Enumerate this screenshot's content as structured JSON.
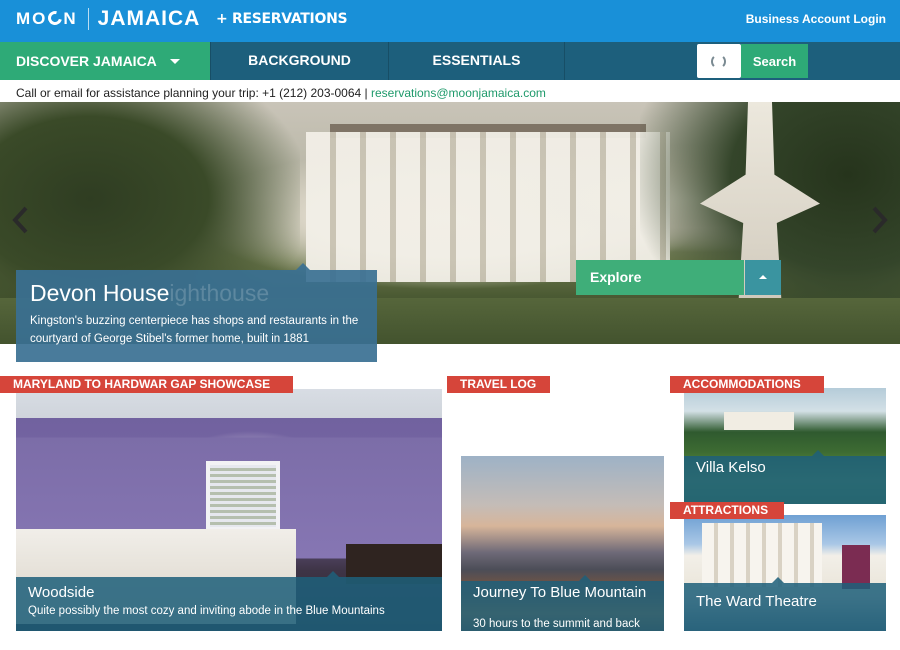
{
  "header": {
    "logo_moon": "MO",
    "logo_moon_end": "N",
    "logo_jamaica": "JAMAICA",
    "reservations": "+ RESERVATIONS",
    "business_login": "Business Account Login"
  },
  "nav": {
    "discover": "DISCOVER JAMAICA",
    "background": "BACKGROUND",
    "essentials": "ESSENTIALS",
    "search": "Search"
  },
  "contact": {
    "text": "Call or email for assistance planning your trip: +1 (212) 203-0064 | ",
    "email": "reservations@moonjamaica.com"
  },
  "hero": {
    "title": "Devon House",
    "ghost_title": "ighthouse",
    "description": "Kingston's buzzing centerpiece has shops and restaurants in the courtyard of George Stibel's former home, built in 1881",
    "explore": "Explore"
  },
  "cards": {
    "showcase": {
      "tag": "MARYLAND TO HARDWAR GAP SHOWCASE",
      "title": "Woodside",
      "subtitle": "Quite possibly the most cozy and inviting abode in the Blue Mountains"
    },
    "travel_log": {
      "tag": "TRAVEL LOG",
      "title": "Journey To Blue Mountain",
      "subtitle": "30 hours to the summit and back"
    },
    "accommodations": {
      "tag": "ACCOMMODATIONS",
      "title": "Villa Kelso"
    },
    "attractions": {
      "tag": "ATTRACTIONS",
      "title": "The Ward Theatre"
    }
  },
  "colors": {
    "topbar": "#1990d8",
    "nav": "#1d5f7c",
    "accent_green": "#2eaa77",
    "tag_red": "#d6453a",
    "overlay_blue": "#1e5f7a"
  }
}
